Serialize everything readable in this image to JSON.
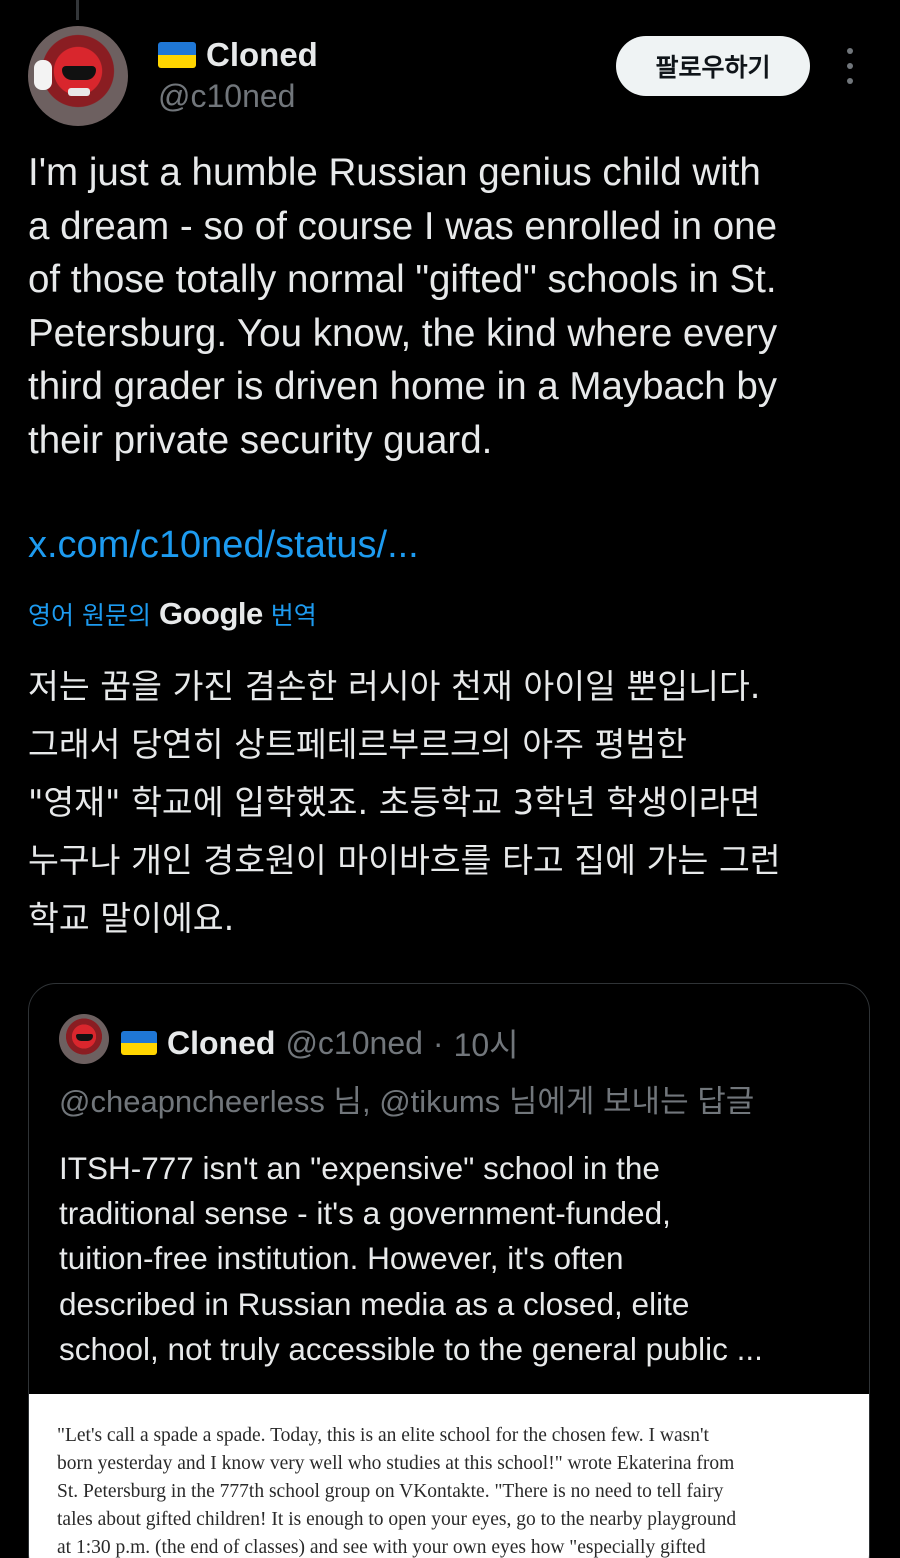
{
  "author": {
    "display_name": "Cloned",
    "handle": "@c10ned",
    "flag_colors": [
      "#1f77d6",
      "#ffd500"
    ]
  },
  "actions": {
    "follow_label": "팔로우하기"
  },
  "tweet": {
    "text": "I'm just a humble Russian genius child with\na dream - so of course I was enrolled in one\nof those totally normal \"gifted\" schools in St.\nPetersburg. You know, the kind where every\nthird grader is driven home in a Maybach by\ntheir private security guard.",
    "link": "x.com/c10ned/status/..."
  },
  "translation": {
    "prefix": "영어 원문의",
    "provider": "Google",
    "suffix": "번역",
    "text": "저는 꿈을 가진 겸손한 러시아 천재 아이일 뿐입니다.\n그래서 당연히 상트페테르부르크의 아주 평범한\n\"영재\" 학교에 입학했죠. 초등학교 3학년 학생이라면\n누구나 개인 경호원이 마이바흐를 타고 집에 가는 그런\n학교 말이에요."
  },
  "quoted": {
    "display_name": "Cloned",
    "handle": "@c10ned",
    "separator": "·",
    "time": "10시",
    "reply_to": "@cheapncheerless 님, @tikums 님에게 보내는 답글",
    "text": "ITSH-777 isn't an \"expensive\" school in the\ntraditional sense - it's a government-funded,\ntuition-free institution. However, it's often\ndescribed in Russian media as a closed, elite\nschool, not truly accessible to the general public ...",
    "media_text": "\"Let's call a spade a spade. Today, this is an elite school for the chosen few. I wasn't\nborn yesterday and I know very well who studies at this school!\" wrote Ekaterina from\nSt. Petersburg in the 777th school group on VKontakte. \"There is no need to tell fairy\ntales about gifted children! It is enough to open your eyes, go to the nearby playground\nat 1:30 p.m. (the end of classes) and see with your own eyes how \"especially gifted"
  },
  "colors": {
    "background": "#000000",
    "text": "#e7e9ea",
    "muted": "#71767b",
    "link": "#1d9bf0",
    "border": "#2f3336"
  },
  "icons": {
    "more": "more-vertical-icon"
  }
}
